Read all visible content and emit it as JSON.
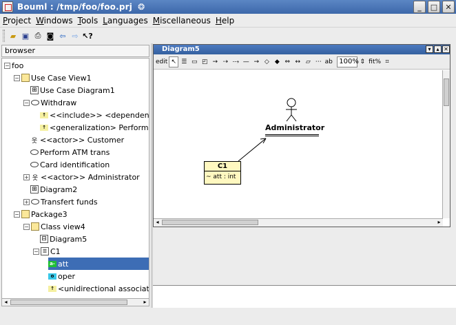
{
  "window": {
    "title": "Bouml : /tmp/foo/foo.prj",
    "buttons": [
      "_",
      "□",
      "✕"
    ]
  },
  "menu": [
    "Project",
    "Windows",
    "Tools",
    "Languages",
    "Miscellaneous",
    "Help"
  ],
  "toolbar": {
    "icons": [
      "open-folder-icon",
      "save-icon",
      "print-icon",
      "binoculars-icon",
      "back-arrow-icon",
      "forward-arrow-icon",
      "whats-this-icon"
    ]
  },
  "browser": {
    "label": "browser",
    "nodes": [
      {
        "label": "foo"
      },
      {
        "label": "Use Case View1"
      },
      {
        "label": "Use Case Diagram1"
      },
      {
        "label": "Withdraw"
      },
      {
        "label": "<<include>> <dependency>"
      },
      {
        "label": "<generalization> Perform AT"
      },
      {
        "label": "<<actor>> Customer"
      },
      {
        "label": "Perform ATM trans"
      },
      {
        "label": "Card identification"
      },
      {
        "label": "<<actor>> Administrator"
      },
      {
        "label": "Diagram2"
      },
      {
        "label": "Transfert funds"
      },
      {
        "label": "Package3"
      },
      {
        "label": "Class view4"
      },
      {
        "label": "Diagram5"
      },
      {
        "label": "C1"
      },
      {
        "label": "att"
      },
      {
        "label": "oper"
      },
      {
        "label": "<unidirectional associatio"
      }
    ]
  },
  "diagram": {
    "title": "Diagram5",
    "edit_label": "edit",
    "zoom": "100%",
    "fit_label": "fit%",
    "actor_name": "Administrator",
    "class_name": "C1",
    "class_attr": "~  att : int"
  }
}
